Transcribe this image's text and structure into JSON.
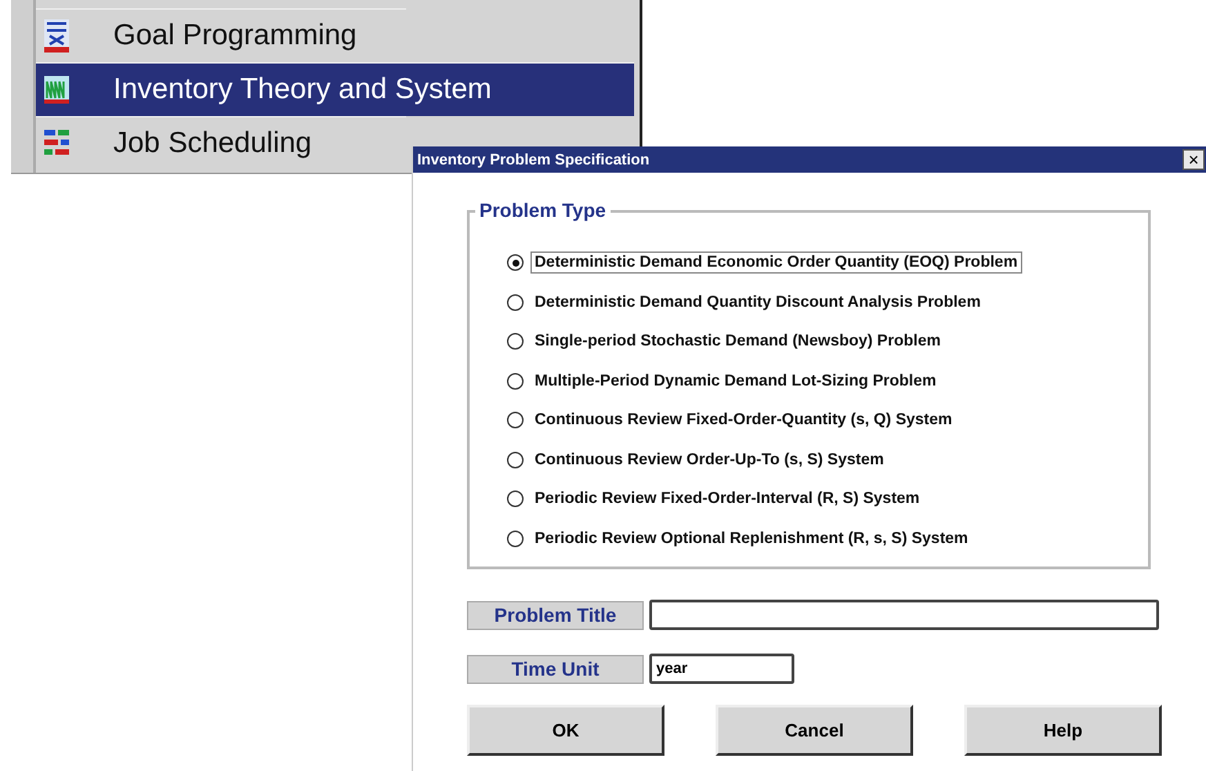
{
  "menu": {
    "items": [
      {
        "label": "Goal Programming",
        "selected": false
      },
      {
        "label": "Inventory Theory and System",
        "selected": true
      },
      {
        "label": "Job Scheduling",
        "selected": false
      }
    ]
  },
  "dialog": {
    "title": "Inventory Problem Specification",
    "close": "×",
    "problem_type": {
      "legend": "Problem Type",
      "options": [
        {
          "label": "Deterministic Demand Economic Order Quantity (EOQ) Problem",
          "selected": true
        },
        {
          "label": "Deterministic Demand Quantity Discount Analysis Problem",
          "selected": false
        },
        {
          "label": "Single-period Stochastic Demand (Newsboy) Problem",
          "selected": false
        },
        {
          "label": "Multiple-Period Dynamic Demand Lot-Sizing Problem",
          "selected": false
        },
        {
          "label": "Continuous Review Fixed-Order-Quantity (s, Q) System",
          "selected": false
        },
        {
          "label": "Continuous Review Order-Up-To (s, S) System",
          "selected": false
        },
        {
          "label": "Periodic Review Fixed-Order-Interval (R, S) System",
          "selected": false
        },
        {
          "label": "Periodic Review Optional Replenishment (R, s, S) System",
          "selected": false
        }
      ]
    },
    "fields": [
      {
        "label": "Problem Title"
      },
      {
        "label": "Time Unit",
        "value": "year"
      }
    ],
    "buttons": [
      "OK",
      "Cancel",
      "Help"
    ]
  }
}
